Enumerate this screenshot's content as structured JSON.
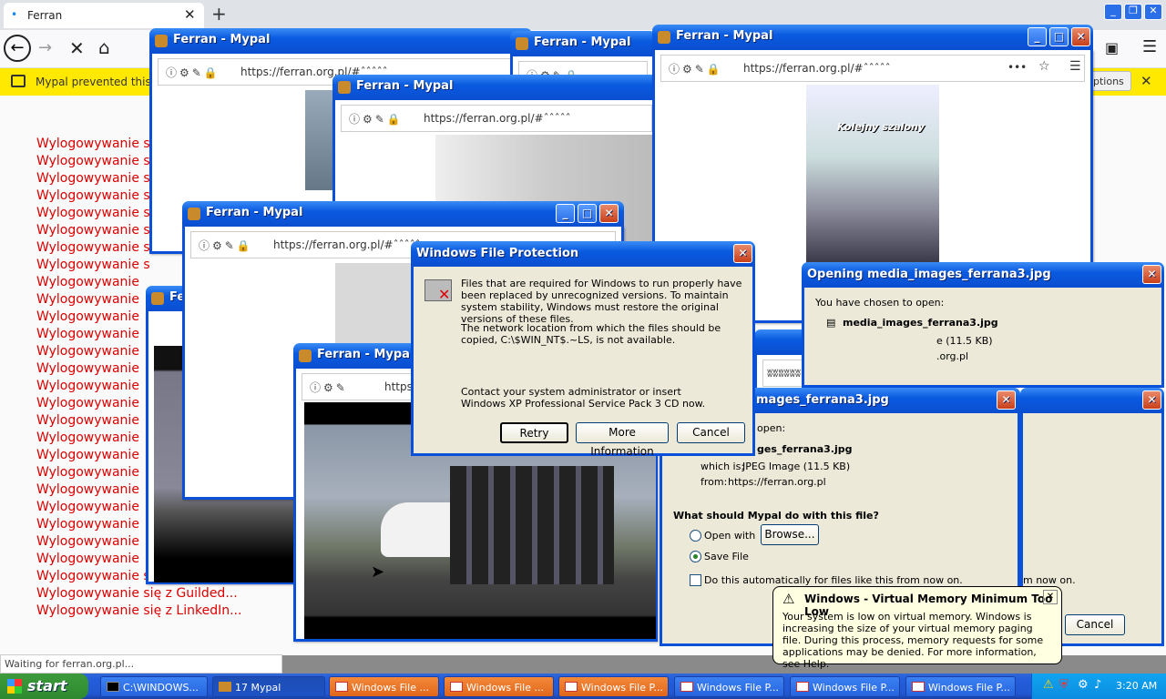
{
  "browser": {
    "tab_title": "Ferran",
    "infobar_text": "Mypal prevented this site",
    "infobar_button": "ptions",
    "status": "Waiting for ferran.org.pl..."
  },
  "page": {
    "logout_lines": [
      "Wylogowywanie s",
      "Wylogowywanie s",
      "Wylogowywanie s",
      "Wylogowywanie s",
      "Wylogowywanie s",
      "Wylogowywanie s",
      "Wylogowywanie s",
      "Wylogowywanie s",
      "Wylogowywanie",
      "Wylogowywanie",
      "Wylogowywanie",
      "Wylogowywanie",
      "Wylogowywanie",
      "Wylogowywanie",
      "Wylogowywanie",
      "Wylogowywanie",
      "Wylogowywanie",
      "Wylogowywanie",
      "Wylogowywanie",
      "Wylogowywanie",
      "Wylogowywanie",
      "Wylogowywanie",
      "Wylogowywanie",
      "Wylogowywanie",
      "Wylogowywanie"
    ],
    "logout_tail": [
      "Wylogowywanie się z ChatGPT...",
      "Wylogowywanie się z Guilded...",
      "Wylogowywanie się z LinkedIn..."
    ]
  },
  "popups": {
    "title": "Ferran - Mypal",
    "url": "https://ferran.org.pl/#ˆˆˆˆˆ",
    "url_a": "https://ferran.org.pl/#",
    "photo_caption": "Kolejny szalony"
  },
  "wfp": {
    "title": "Windows File Protection",
    "p1": "Files that are required for Windows to run properly have been replaced by unrecognized versions.  To maintain system stability, Windows must restore the original versions of these files.",
    "p2": "The network location from which the files should be copied, C:\\$WIN_NT$.~LS, is not available.",
    "p3": "Contact your system administrator or insert Windows XP Professional Service Pack 3 CD now.",
    "retry": "Retry",
    "more": "More Information",
    "cancel": "Cancel"
  },
  "opening": {
    "title": "Opening media_images_ferrana3.jpg",
    "title2": "mages_ferrana3.jpg",
    "chosen": "You have chosen to open:",
    "chosen2": "open:",
    "filename": "media_images_ferrana3.jpg",
    "filename2": "ges_ferrana3.jpg",
    "which_label": "which is:",
    "which_value": "JPEG Image (11.5 KB)",
    "which_short": "e (11.5 KB)",
    "from_label": "from:",
    "from_value": "https://ferran.org.pl",
    "from_short": ".org.pl",
    "question": "What should Mypal do with this file?",
    "open_with": "Open with",
    "browse": "Browse...",
    "save_file": "Save File",
    "auto": "Do this automatically for files like this from now on.",
    "auto_tail": "m now on.",
    "cancel": "Cancel"
  },
  "balloon": {
    "title": "Windows - Virtual Memory Minimum Too Low",
    "text": "Your system is low on virtual memory. Windows is increasing the size of your virtual memory paging file. During this process, memory requests for some applications may be denied. For more information, see Help."
  },
  "taskbar": {
    "start": "start",
    "cmd": "C:\\WINDOWS...",
    "mypal": "17 Mypal",
    "wfp1": "Windows File ...",
    "wfp2": "Windows File ...",
    "wfp3": "Windows File P...",
    "wfp4": "Windows File P...",
    "wfp5": "Windows File P...",
    "wfp6": "Windows File P...",
    "clock": "3:20 AM"
  },
  "colors": {
    "xp_blue": "#0a50d8",
    "logout_red": "#dd0000",
    "infobar": "#ffe900"
  }
}
